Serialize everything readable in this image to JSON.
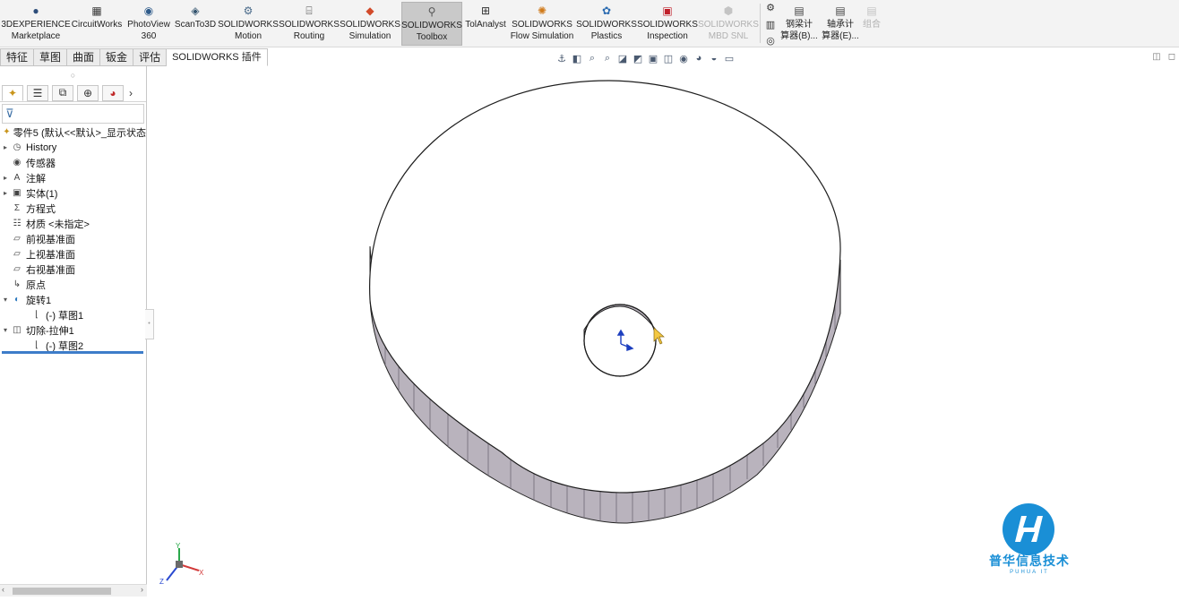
{
  "ribbon": {
    "buttons": [
      {
        "line1": "3DEXPERIENCE",
        "line2": "Marketplace",
        "icon": "3dexperience-icon"
      },
      {
        "line1": "CircuitWorks",
        "line2": "",
        "icon": "circuitworks-icon"
      },
      {
        "line1": "PhotoView",
        "line2": "360",
        "icon": "photoview-icon"
      },
      {
        "line1": "ScanTo3D",
        "line2": "",
        "icon": "scanto3d-icon"
      },
      {
        "line1": "SOLIDWORKS",
        "line2": "Motion",
        "icon": "motion-icon"
      },
      {
        "line1": "SOLIDWORKS",
        "line2": "Routing",
        "icon": "routing-icon"
      },
      {
        "line1": "SOLIDWORKS",
        "line2": "Simulation",
        "icon": "simulation-icon"
      },
      {
        "line1": "SOLIDWORKS",
        "line2": "Toolbox",
        "icon": "toolbox-icon"
      },
      {
        "line1": "TolAnalyst",
        "line2": "",
        "icon": "tolanalyst-icon"
      },
      {
        "line1": "SOLIDWORKS",
        "line2": "Flow Simulation",
        "icon": "flow-simulation-icon"
      },
      {
        "line1": "SOLIDWORKS",
        "line2": "Plastics",
        "icon": "plastics-icon"
      },
      {
        "line1": "SOLIDWORKS",
        "line2": "Inspection",
        "icon": "inspection-icon"
      },
      {
        "line1": "SOLIDWORKS",
        "line2": "MBD SNL",
        "icon": "mbd-snl-icon"
      }
    ],
    "calc": [
      {
        "line1": "钢梁计",
        "line2": "算器(B)...",
        "icon": "beam-calculator-icon"
      },
      {
        "line1": "轴承计",
        "line2": "算器(E)...",
        "icon": "bearing-calculator-icon"
      },
      {
        "line1": "组合",
        "line2": "",
        "icon": "combine-icon"
      }
    ]
  },
  "tabs": [
    "特征",
    "草图",
    "曲面",
    "钣金",
    "评估",
    "SOLIDWORKS 插件"
  ],
  "tree": {
    "root": "零件5 (默认<<默认>_显示状态",
    "items": [
      {
        "label": "History",
        "icon": "history-folder-icon",
        "expandable": true
      },
      {
        "label": "传感器",
        "icon": "sensors-icon",
        "expandable": false
      },
      {
        "label": "注解",
        "icon": "annotations-icon",
        "expandable": true
      },
      {
        "label": "实体(1)",
        "icon": "solid-bodies-icon",
        "expandable": true
      },
      {
        "label": "方程式",
        "icon": "equations-icon",
        "expandable": false
      },
      {
        "label": "材质 <未指定>",
        "icon": "material-icon",
        "expandable": false
      },
      {
        "label": "前视基准面",
        "icon": "plane-icon",
        "expandable": false
      },
      {
        "label": "上视基准面",
        "icon": "plane-icon",
        "expandable": false
      },
      {
        "label": "右视基准面",
        "icon": "plane-icon",
        "expandable": false
      },
      {
        "label": "原点",
        "icon": "origin-icon",
        "expandable": false
      },
      {
        "label": "旋转1",
        "icon": "revolve-icon",
        "expandable": true,
        "expanded": true
      },
      {
        "label": "(-) 草图1",
        "icon": "sketch-icon",
        "child": true
      },
      {
        "label": "切除-拉伸1",
        "icon": "cut-extrude-icon",
        "expandable": true,
        "expanded": true
      },
      {
        "label": "(-) 草图2",
        "icon": "sketch-icon",
        "child": true
      }
    ]
  },
  "triad": {
    "x": "X",
    "y": "Y",
    "z": "Z"
  },
  "watermark": {
    "name": "普华信息技术",
    "sub": "PUHUA IT"
  },
  "colors": {
    "ribbon_bg": "#f3f3f3",
    "active_button": "#c9c9c9",
    "selection": "#3d7cc9",
    "side_wall": "#b7b1bb",
    "logo": "#1a8fd6"
  }
}
